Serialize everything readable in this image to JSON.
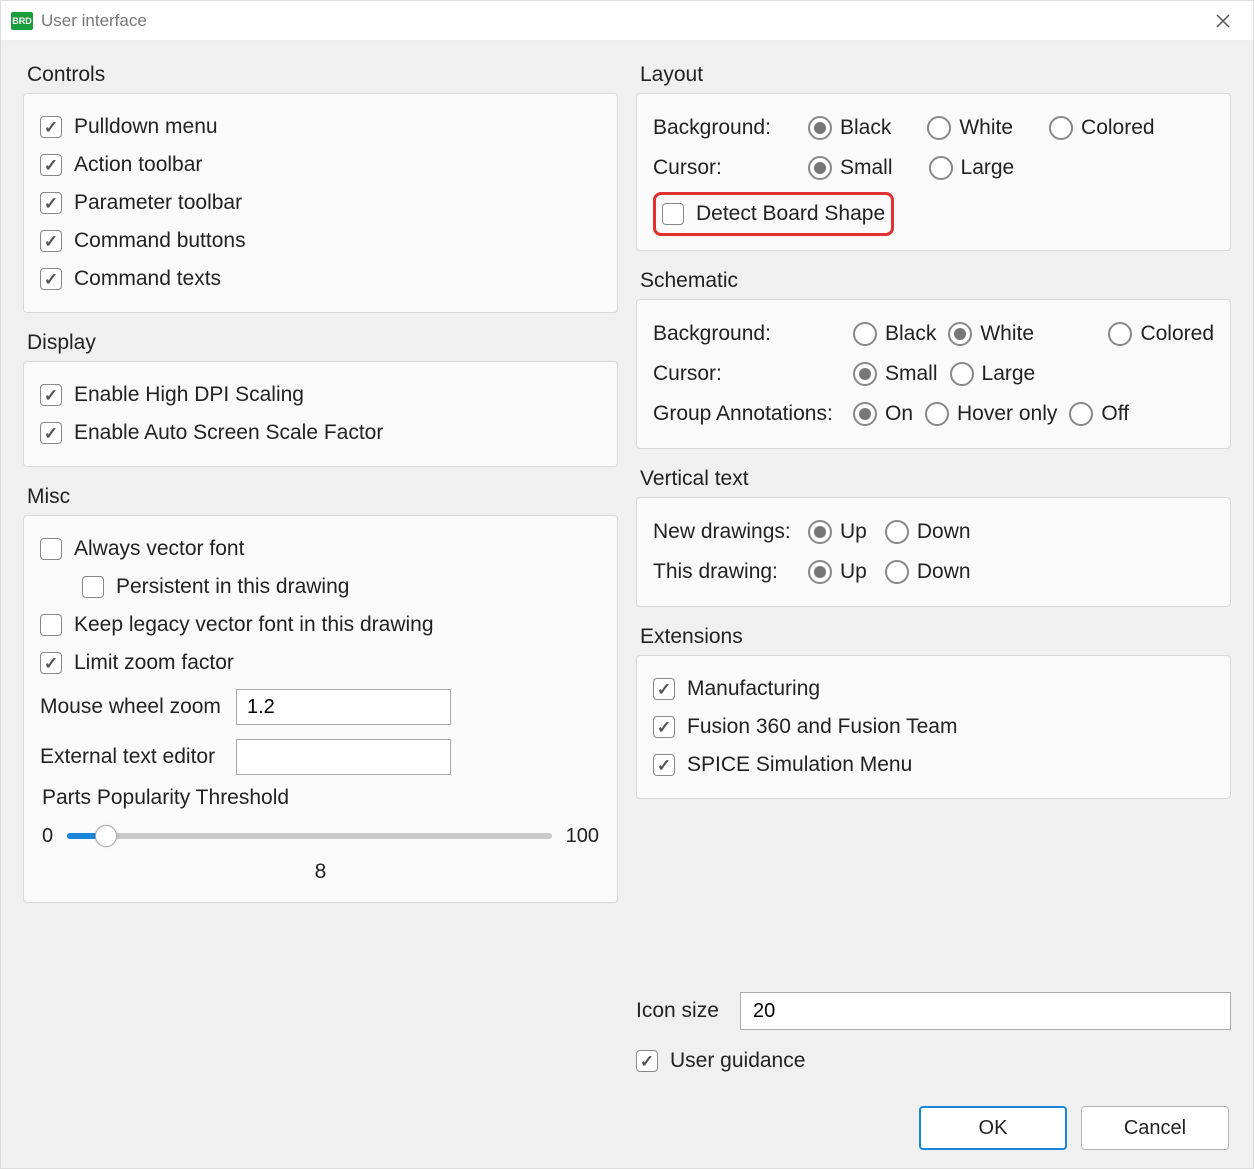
{
  "window": {
    "title": "User interface"
  },
  "controls": {
    "title": "Controls",
    "items": [
      {
        "label": "Pulldown menu",
        "checked": true
      },
      {
        "label": "Action toolbar",
        "checked": true
      },
      {
        "label": "Parameter toolbar",
        "checked": true
      },
      {
        "label": "Command buttons",
        "checked": true
      },
      {
        "label": "Command texts",
        "checked": true
      }
    ]
  },
  "display": {
    "title": "Display",
    "items": [
      {
        "label": "Enable High DPI Scaling",
        "checked": true
      },
      {
        "label": "Enable Auto Screen Scale Factor",
        "checked": true
      }
    ]
  },
  "misc": {
    "title": "Misc",
    "always_vector_font": {
      "label": "Always vector font",
      "checked": false
    },
    "persistent": {
      "label": "Persistent in this drawing",
      "checked": false
    },
    "keep_legacy": {
      "label": "Keep legacy vector font in this drawing",
      "checked": false
    },
    "limit_zoom": {
      "label": "Limit zoom factor",
      "checked": true
    },
    "mouse_wheel_zoom": {
      "label": "Mouse wheel zoom",
      "value": "1.2"
    },
    "external_editor": {
      "label": "External text editor",
      "value": ""
    },
    "parts_threshold": {
      "label": "Parts Popularity Threshold",
      "min": "0",
      "max": "100",
      "value": "8"
    }
  },
  "layout": {
    "title": "Layout",
    "background": {
      "label": "Background:",
      "options": [
        "Black",
        "White",
        "Colored"
      ],
      "selected": "Black"
    },
    "cursor": {
      "label": "Cursor:",
      "options": [
        "Small",
        "Large"
      ],
      "selected": "Small"
    },
    "detect_board_shape": {
      "label": "Detect Board Shape",
      "checked": false
    }
  },
  "schematic": {
    "title": "Schematic",
    "background": {
      "label": "Background:",
      "options": [
        "Black",
        "White",
        "Colored"
      ],
      "selected": "White"
    },
    "cursor": {
      "label": "Cursor:",
      "options": [
        "Small",
        "Large"
      ],
      "selected": "Small"
    },
    "group_annotations": {
      "label": "Group Annotations:",
      "options": [
        "On",
        "Hover only",
        "Off"
      ],
      "selected": "On"
    }
  },
  "vertical_text": {
    "title": "Vertical text",
    "new_drawings": {
      "label": "New drawings:",
      "options": [
        "Up",
        "Down"
      ],
      "selected": "Up"
    },
    "this_drawing": {
      "label": "This drawing:",
      "options": [
        "Up",
        "Down"
      ],
      "selected": "Up"
    }
  },
  "extensions": {
    "title": "Extensions",
    "items": [
      {
        "label": "Manufacturing",
        "checked": true
      },
      {
        "label": "Fusion 360 and Fusion Team",
        "checked": true
      },
      {
        "label": "SPICE Simulation Menu",
        "checked": true
      }
    ]
  },
  "icon_size": {
    "label": "Icon size",
    "value": "20"
  },
  "user_guidance": {
    "label": "User guidance",
    "checked": true
  },
  "buttons": {
    "ok": "OK",
    "cancel": "Cancel"
  }
}
